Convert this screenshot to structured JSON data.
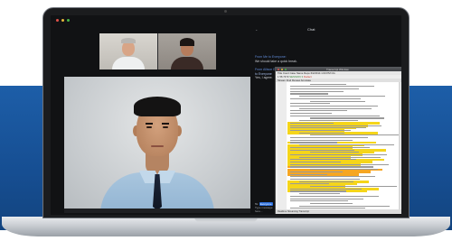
{
  "colors": {
    "background_band": "#1d5ea8",
    "laptop_silver": "#c9cdd2",
    "screen_bg": "#111214",
    "chat_sender": "#5f8ad6",
    "highlight_yellow": "#f5d51a",
    "highlight_orange": "#f6a623",
    "recipient_pill": "#2c6fdd"
  },
  "window": {
    "controls": [
      "close-dot",
      "minimize-dot",
      "zoom-dot"
    ]
  },
  "gallery": {
    "participants": [
      {
        "label": "participant-1"
      },
      {
        "label": "participant-2"
      }
    ]
  },
  "main_video": {
    "speaker": "active-speaker"
  },
  "chat": {
    "title": "Chat",
    "messages": [
      {
        "from": "From Me to Everyone:",
        "text": "We should take a quick break."
      },
      {
        "from": "From Allison Eller to",
        "to": "Me (Privately)",
        "to2": "to Everyone",
        "text": "Yes, I agree."
      }
    ],
    "input": {
      "to_label": "To:",
      "recipient": "Everyone",
      "placeholder": "Type message here..."
    }
  },
  "document": {
    "window_title": "Transcript Window",
    "bar1": "Title  Court Case Name    Depo  6/2/2014 1:03 PM CG",
    "bar2_left": "1 56:7473  ",
    "bar2_green": "SESSION 3",
    "bar2_mid": "  ",
    "bar2_red": "Redact",
    "bar3": "Stream  Find  Review  Annotate",
    "status": "Realtime  Streaming  Transcript"
  }
}
